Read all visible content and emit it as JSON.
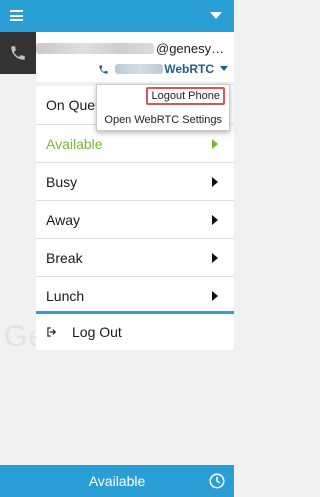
{
  "header": {
    "menu_icon": "hamburger-icon",
    "dropdown_icon": "caret-down-icon"
  },
  "account": {
    "email_suffix": "@genesy…",
    "station_suffix": "WebRTC",
    "phone_icon": "phone-icon"
  },
  "status_menu": {
    "items": [
      {
        "label": "On Queue",
        "active": false
      },
      {
        "label": "Available",
        "active": true
      },
      {
        "label": "Busy",
        "active": false
      },
      {
        "label": "Away",
        "active": false
      },
      {
        "label": "Break",
        "active": false
      },
      {
        "label": "Lunch",
        "active": false
      }
    ],
    "logout_label": "Log Out"
  },
  "phone_menu": {
    "logout_phone_label": "Logout Phone",
    "webrtc_settings_label": "Open WebRTC Settings"
  },
  "footer": {
    "status_label": "Available",
    "clock_icon": "clock-icon"
  },
  "colors": {
    "accent": "#2a9fd6",
    "available_green": "#7cb832",
    "highlight_border": "#e05252",
    "dark_block": "#333333"
  }
}
